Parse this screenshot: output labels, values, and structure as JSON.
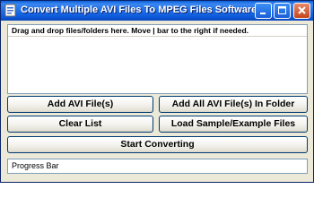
{
  "window": {
    "title": "Convert Multiple AVI Files To MPEG Files Software",
    "controls": {
      "minimize_icon": "minimize-icon",
      "maximize_icon": "maximize-icon",
      "close_icon": "close-icon"
    },
    "app_icon": "app-icon"
  },
  "dropzone": {
    "instruction": "Drag and drop files/folders here. Move | bar to the right if needed."
  },
  "buttons": {
    "add_files": "Add AVI File(s)",
    "add_folder": "Add All AVI File(s) In Folder",
    "clear_list": "Clear List",
    "load_sample": "Load Sample/Example Files",
    "start": "Start Converting"
  },
  "status": {
    "progress_label": "Progress Bar"
  },
  "colors": {
    "titlebar": "#0a5fd8",
    "window_bg": "#ece9d8",
    "button_border": "#003c74",
    "field_border": "#7f9db9"
  }
}
